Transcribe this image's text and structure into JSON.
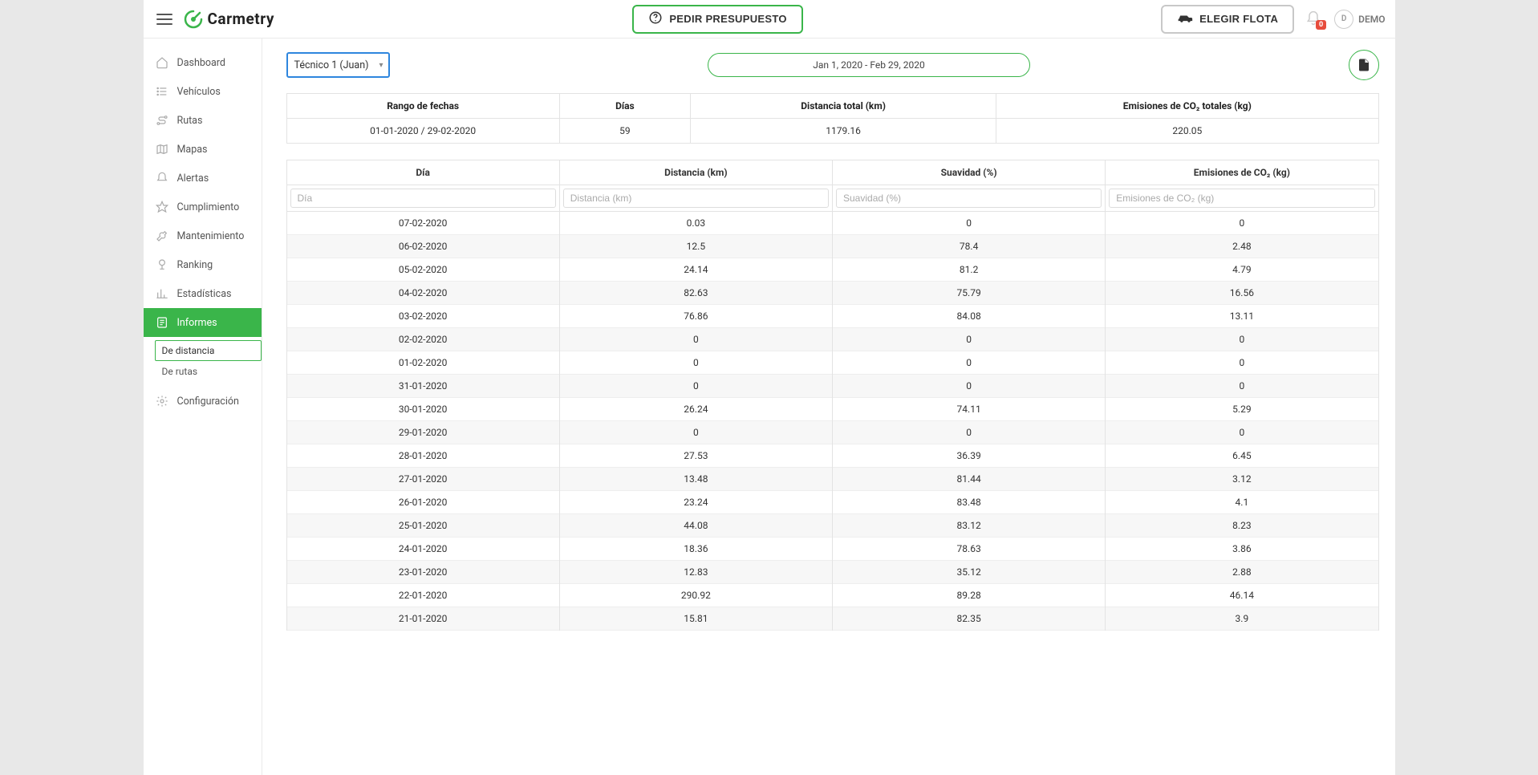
{
  "brand": "Carmetry",
  "header": {
    "quote_label": "PEDIR PRESUPUESTO",
    "fleet_label": "ELEGIR FLOTA",
    "notif_count": "0",
    "user_initial": "D",
    "user_name": "DEMO"
  },
  "sidebar": {
    "items": [
      {
        "label": "Dashboard"
      },
      {
        "label": "Vehículos"
      },
      {
        "label": "Rutas"
      },
      {
        "label": "Mapas"
      },
      {
        "label": "Alertas"
      },
      {
        "label": "Cumplimiento"
      },
      {
        "label": "Mantenimiento"
      },
      {
        "label": "Ranking"
      },
      {
        "label": "Estadísticas"
      },
      {
        "label": "Informes"
      },
      {
        "label": "Configuración"
      }
    ],
    "informes_sub": [
      {
        "label": "De distancia"
      },
      {
        "label": "De rutas"
      }
    ]
  },
  "toolbar": {
    "technician": "Técnico 1 (Juan)",
    "date_range": "Jan 1, 2020 - Feb 29, 2020"
  },
  "summary": {
    "headers": {
      "range": "Rango de fechas",
      "days": "Días",
      "dist": "Distancia total (km)",
      "co2": "Emisiones de CO₂ totales (kg)"
    },
    "row": {
      "range": "01-01-2020 / 29-02-2020",
      "days": "59",
      "dist": "1179.16",
      "co2": "220.05"
    }
  },
  "table": {
    "headers": {
      "day": "Día",
      "dist": "Distancia (km)",
      "smooth": "Suavidad (%)",
      "co2": "Emisiones de CO₂ (kg)"
    },
    "filters": {
      "day": "Día",
      "dist": "Distancia (km)",
      "smooth": "Suavidad (%)",
      "co2": "Emisiones de CO₂ (kg)"
    },
    "rows": [
      {
        "day": "07-02-2020",
        "dist": "0.03",
        "smooth": "0",
        "co2": "0"
      },
      {
        "day": "06-02-2020",
        "dist": "12.5",
        "smooth": "78.4",
        "co2": "2.48"
      },
      {
        "day": "05-02-2020",
        "dist": "24.14",
        "smooth": "81.2",
        "co2": "4.79"
      },
      {
        "day": "04-02-2020",
        "dist": "82.63",
        "smooth": "75.79",
        "co2": "16.56"
      },
      {
        "day": "03-02-2020",
        "dist": "76.86",
        "smooth": "84.08",
        "co2": "13.11"
      },
      {
        "day": "02-02-2020",
        "dist": "0",
        "smooth": "0",
        "co2": "0"
      },
      {
        "day": "01-02-2020",
        "dist": "0",
        "smooth": "0",
        "co2": "0"
      },
      {
        "day": "31-01-2020",
        "dist": "0",
        "smooth": "0",
        "co2": "0"
      },
      {
        "day": "30-01-2020",
        "dist": "26.24",
        "smooth": "74.11",
        "co2": "5.29"
      },
      {
        "day": "29-01-2020",
        "dist": "0",
        "smooth": "0",
        "co2": "0"
      },
      {
        "day": "28-01-2020",
        "dist": "27.53",
        "smooth": "36.39",
        "co2": "6.45"
      },
      {
        "day": "27-01-2020",
        "dist": "13.48",
        "smooth": "81.44",
        "co2": "3.12"
      },
      {
        "day": "26-01-2020",
        "dist": "23.24",
        "smooth": "83.48",
        "co2": "4.1"
      },
      {
        "day": "25-01-2020",
        "dist": "44.08",
        "smooth": "83.12",
        "co2": "8.23"
      },
      {
        "day": "24-01-2020",
        "dist": "18.36",
        "smooth": "78.63",
        "co2": "3.86"
      },
      {
        "day": "23-01-2020",
        "dist": "12.83",
        "smooth": "35.12",
        "co2": "2.88"
      },
      {
        "day": "22-01-2020",
        "dist": "290.92",
        "smooth": "89.28",
        "co2": "46.14"
      },
      {
        "day": "21-01-2020",
        "dist": "15.81",
        "smooth": "82.35",
        "co2": "3.9"
      }
    ]
  }
}
